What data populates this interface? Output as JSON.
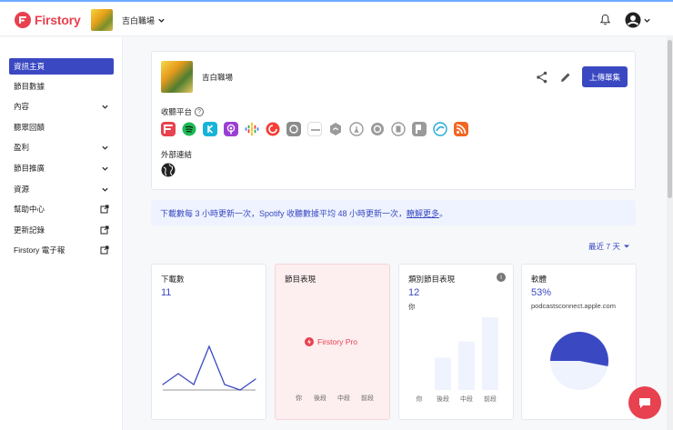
{
  "app": {
    "name": "Firstory",
    "brand_color": "#e8414f",
    "accent_color": "#3a49c2"
  },
  "header": {
    "show_name": "吉白職場",
    "bell_icon": "bell-icon",
    "user_icon": "account-icon"
  },
  "sidebar": {
    "items": [
      {
        "label": "資訊主頁",
        "active": true,
        "suffix": ""
      },
      {
        "label": "節目數據",
        "suffix": ""
      },
      {
        "label": "內容",
        "suffix": "chevron"
      },
      {
        "label": "聽眾回饋",
        "suffix": ""
      },
      {
        "label": "盈利",
        "suffix": "chevron"
      },
      {
        "label": "節目推廣",
        "suffix": "chevron"
      },
      {
        "label": "資源",
        "suffix": "chevron"
      },
      {
        "label": "幫助中心",
        "suffix": "external"
      },
      {
        "label": "更新記錄",
        "suffix": "external"
      },
      {
        "label": "Firstory 電子報",
        "suffix": "external"
      }
    ]
  },
  "show_card": {
    "title": "吉白職場",
    "upload_label": "上傳單集",
    "platforms_label": "收聽平台",
    "platforms": [
      {
        "name": "firstory-icon",
        "color": "#e8414f"
      },
      {
        "name": "spotify-icon",
        "color": "#1db954"
      },
      {
        "name": "kkbox-icon",
        "color": "#17b3d8"
      },
      {
        "name": "apple-podcasts-icon",
        "color": "#9b3fd4"
      },
      {
        "name": "google-podcasts-icon",
        "color": "#4285f4"
      },
      {
        "name": "pocket-casts-icon",
        "color": "#f43e37"
      },
      {
        "name": "castbox-icon",
        "color": "#9a9a9a"
      },
      {
        "name": "soundon-icon",
        "color": "#9a9a9a"
      },
      {
        "name": "podcast-addict-icon",
        "color": "#9a9a9a"
      },
      {
        "name": "overcast-icon",
        "color": "#9a9a9a"
      },
      {
        "name": "podbean-icon",
        "color": "#9a9a9a"
      },
      {
        "name": "player-fm-icon",
        "color": "#9a9a9a"
      },
      {
        "name": "podcast-republic-icon",
        "color": "#9a9a9a"
      },
      {
        "name": "himalaya-icon",
        "color": "#23a8d6"
      },
      {
        "name": "rss-icon",
        "color": "#f26522"
      }
    ],
    "external_label": "外部連結"
  },
  "notice": {
    "text": "下載數每 3 小時更新一次，Spotify 收聽數據平均 48 小時更新一次，",
    "link": "瞭解更多",
    "end": "。"
  },
  "range": {
    "label": "最近 7 天"
  },
  "stats": {
    "downloads": {
      "title": "下載數",
      "value": "11"
    },
    "episode_performance": {
      "title": "節目表現",
      "pro_label": "Firstory Pro",
      "labels": [
        "你",
        "後段",
        "中段",
        "前段"
      ]
    },
    "category_performance": {
      "title": "類別節目表現",
      "value": "12",
      "sub": "你",
      "labels": [
        "你",
        "後段",
        "中段",
        "前段"
      ]
    },
    "software": {
      "title": "軟體",
      "value": "53%",
      "sub": "podcastsconnect.apple.com"
    }
  },
  "chart_data": [
    {
      "type": "line",
      "title": "下載數",
      "x": [
        1,
        2,
        3,
        4,
        5,
        6,
        7
      ],
      "values": [
        1,
        3,
        1,
        8,
        1,
        0,
        2
      ],
      "ylim": [
        0,
        10
      ]
    },
    {
      "type": "bar",
      "title": "類別節目表現",
      "categories": [
        "你",
        "後段",
        "中段",
        "前段"
      ],
      "values": [
        0,
        4,
        6,
        9
      ]
    },
    {
      "type": "pie",
      "title": "軟體",
      "categories": [
        "podcastsconnect.apple.com",
        "其他"
      ],
      "values": [
        53,
        47
      ]
    }
  ]
}
